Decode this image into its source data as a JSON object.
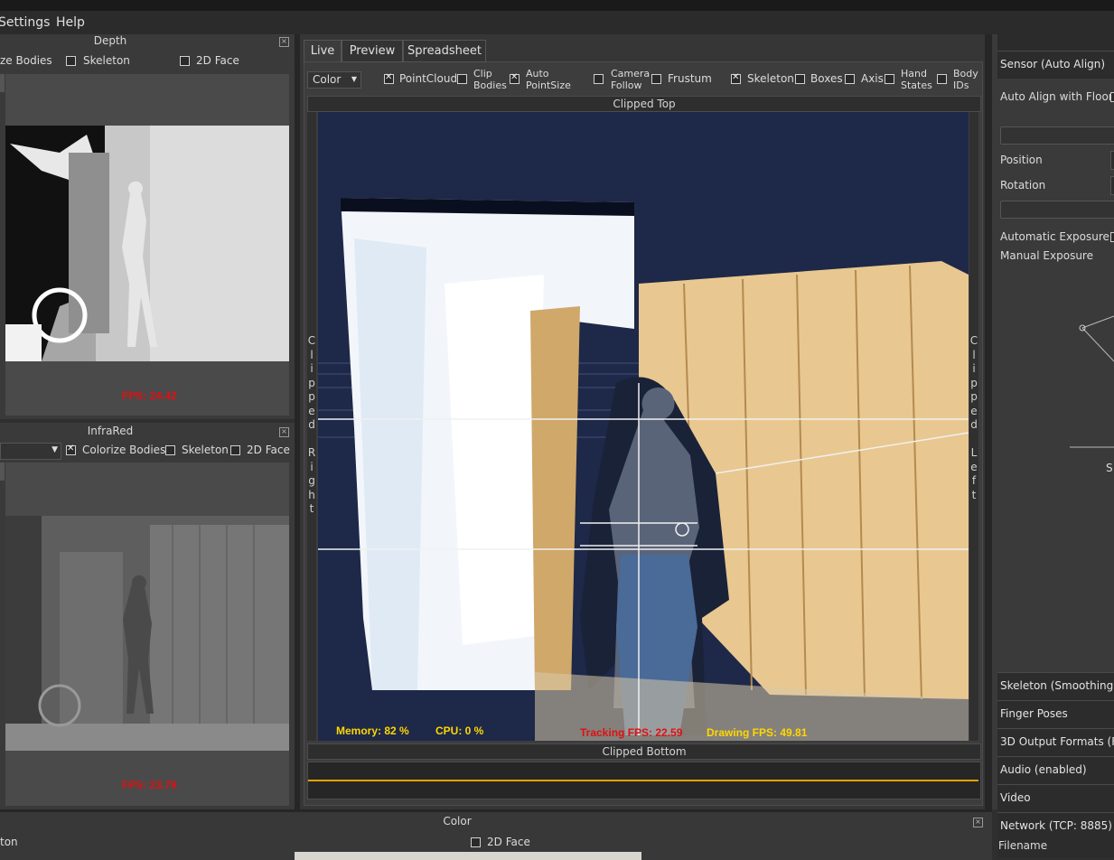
{
  "menu": {
    "settings": "Settings",
    "help": "Help"
  },
  "depth_panel": {
    "title": "Depth",
    "options": {
      "colorize_bodies": "ze Bodies",
      "skeleton": "Skeleton",
      "face2d": "2D Face"
    },
    "fps": "FPS: 24.42"
  },
  "infrared_panel": {
    "title": "InfraRed",
    "options": {
      "colorize_bodies": "Colorize Bodies",
      "skeleton": "Skeleton",
      "face2d": "2D Face"
    },
    "fps": "FPS: 23.79"
  },
  "color_panel": {
    "title": "Color",
    "left_label": "ton",
    "face2d": "2D Face"
  },
  "tabs": [
    "Live",
    "Preview",
    "Spreadsheet"
  ],
  "toolbar": {
    "mode_select": "Color",
    "pointcloud": "PointCloud",
    "clip_bodies": [
      "Clip",
      "Bodies"
    ],
    "auto_pointsize": [
      "Auto",
      "PointSize"
    ],
    "camera_follow": [
      "Camera",
      "Follow"
    ],
    "frustum": "Frustum",
    "skeleton": "Skeleton",
    "boxes": "Boxes",
    "axis": "Axis",
    "hand_states": [
      "Hand",
      "States"
    ],
    "body_ids": [
      "Body",
      "IDs"
    ]
  },
  "view": {
    "clipped_top": "Clipped Top",
    "clipped_bottom": "Clipped Bottom",
    "clipped_right": "Clipped Right",
    "clipped_left": "Clipped Left",
    "memory": "Memory:  82 %",
    "cpu": "CPU:  0 %",
    "tracking_fps": "Tracking FPS: 22.59",
    "drawing_fps": "Drawing FPS: 49.81"
  },
  "right_panel": {
    "sensor_header": "Sensor (Auto Align)",
    "auto_align": "Auto Align with Floor",
    "position": "Position",
    "rotation": "Rotation",
    "auto_exposure": "Automatic Exposure",
    "manual_exposure": "Manual Exposure",
    "partial_label": "S",
    "sections": [
      "Skeleton (Smoothing)",
      "Finger Poses",
      "3D Output Formats (Fi",
      "Audio (enabled)",
      "Video",
      "Network (TCP: 8885)"
    ],
    "filename": "Filename"
  },
  "colors": {
    "fps_red": "#e01010",
    "stat_yellow": "#ffd700",
    "accent_orange": "#e8a000",
    "scene_bg": "#1e2848"
  }
}
